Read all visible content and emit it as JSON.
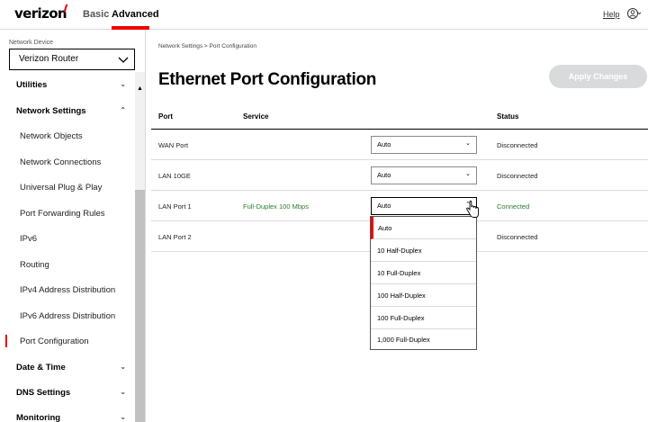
{
  "header": {
    "logo": "verizon",
    "tabs": [
      {
        "label": "Basic"
      },
      {
        "label": "Advanced"
      }
    ],
    "help": "Help"
  },
  "sidebar": {
    "device_label": "Network Device",
    "device_value": "Verizon Router",
    "items": [
      {
        "label": "Utilities",
        "type": "group"
      },
      {
        "label": "Network Settings",
        "type": "group"
      },
      {
        "label": "Network Objects"
      },
      {
        "label": "Network Connections"
      },
      {
        "label": "Universal Plug & Play"
      },
      {
        "label": "Port Forwarding Rules"
      },
      {
        "label": "IPv6"
      },
      {
        "label": "Routing"
      },
      {
        "label": "IPv4 Address Distribution"
      },
      {
        "label": "IPv6 Address Distribution"
      },
      {
        "label": "Port Configuration",
        "active": true
      },
      {
        "label": "Date & Time",
        "type": "group"
      },
      {
        "label": "DNS Settings",
        "type": "group"
      },
      {
        "label": "Monitoring",
        "type": "group"
      }
    ]
  },
  "main": {
    "breadcrumb": "Network Settings  >  Port Configuration",
    "title": "Ethernet Port Configuration",
    "apply_button": "Apply Changes",
    "columns": {
      "port": "Port",
      "service": "Service",
      "status": "Status"
    },
    "rows": [
      {
        "port": "WAN Port",
        "service": "",
        "select": "Auto",
        "status": "Disconnected"
      },
      {
        "port": "LAN 10GE",
        "service": "",
        "select": "Auto",
        "status": "Disconnected"
      },
      {
        "port": "LAN Port 1",
        "service": "Full-Duplex 100 Mbps",
        "select": "Auto",
        "status": "Connected"
      },
      {
        "port": "LAN Port 2",
        "service": "",
        "select": "",
        "status": "Disconnected"
      }
    ],
    "dropdown_options": [
      "Auto",
      "10 Half-Duplex",
      "10 Full-Duplex",
      "100 Half-Duplex",
      "100 Full-Duplex",
      "1,000 Full-Duplex"
    ]
  },
  "colors": {
    "accent": "#ee0000",
    "connected": "#2a7a2a",
    "button_disabled": "#d8dadb"
  }
}
